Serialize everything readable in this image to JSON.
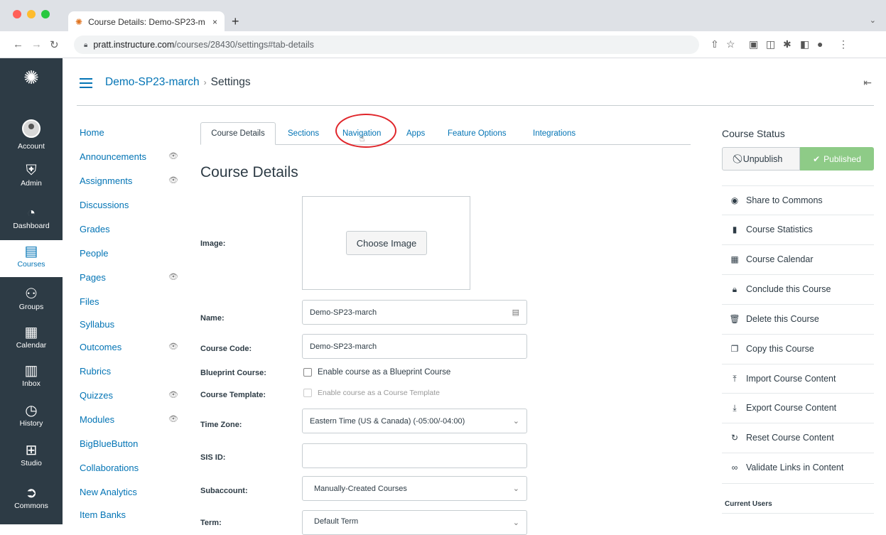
{
  "browser": {
    "tab_title": "Course Details: Demo-SP23-m",
    "tab_close": "×",
    "new_tab": "+",
    "url_host": "pratt.instructure.com",
    "url_path": "/courses/28430/settings#tab-details"
  },
  "global_nav": [
    {
      "label": "Account",
      "icon": "account-avatar"
    },
    {
      "label": "Admin",
      "icon": "shield-icon"
    },
    {
      "label": "Dashboard",
      "icon": "dashboard-icon"
    },
    {
      "label": "Courses",
      "icon": "courses-icon"
    },
    {
      "label": "Groups",
      "icon": "groups-icon"
    },
    {
      "label": "Calendar",
      "icon": "calendar-icon"
    },
    {
      "label": "Inbox",
      "icon": "inbox-icon"
    },
    {
      "label": "History",
      "icon": "history-icon"
    },
    {
      "label": "Studio",
      "icon": "studio-icon"
    },
    {
      "label": "Commons",
      "icon": "commons-icon"
    }
  ],
  "breadcrumb": {
    "course": "Demo-SP23-march",
    "page": "Settings"
  },
  "course_nav": [
    "Home",
    "Announcements",
    "Assignments",
    "Discussions",
    "Grades",
    "People",
    "Pages",
    "Files",
    "Syllabus",
    "Outcomes",
    "Rubrics",
    "Quizzes",
    "Modules",
    "BigBlueButton",
    "Collaborations",
    "New Analytics",
    "Item Banks"
  ],
  "tabs": {
    "details": "Course Details",
    "sections": "Sections",
    "navigation": "Navigation",
    "apps": "Apps",
    "feature_options": "Feature Options",
    "integrations": "Integrations"
  },
  "form": {
    "title": "Course Details",
    "image_label": "Image:",
    "choose_image": "Choose Image",
    "name_label": "Name:",
    "name_value": "Demo-SP23-march",
    "code_label": "Course Code:",
    "code_value": "Demo-SP23-march",
    "blueprint_label": "Blueprint Course:",
    "blueprint_option": "Enable course as a Blueprint Course",
    "template_label": "Course Template:",
    "template_option": "Enable course as a Course Template",
    "timezone_label": "Time Zone:",
    "timezone_value": "Eastern Time (US & Canada) (-05:00/-04:00)",
    "sis_label": "SIS ID:",
    "subaccount_label": "Subaccount:",
    "subaccount_value": "Manually-Created Courses",
    "term_label": "Term:",
    "term_value": "Default Term"
  },
  "status": {
    "title": "Course Status",
    "unpublish": "Unpublish",
    "published": "Published",
    "published_color": "#8ecb87"
  },
  "actions": [
    {
      "label": "Share to Commons",
      "icon": "commons-icon"
    },
    {
      "label": "Course Statistics",
      "icon": "statistics-icon"
    },
    {
      "label": "Course Calendar",
      "icon": "calendar-icon"
    },
    {
      "label": "Conclude this Course",
      "icon": "lock-icon"
    },
    {
      "label": "Delete this Course",
      "icon": "trash-icon"
    },
    {
      "label": "Copy this Course",
      "icon": "copy-icon"
    },
    {
      "label": "Import Course Content",
      "icon": "import-icon"
    },
    {
      "label": "Export Course Content",
      "icon": "export-icon"
    },
    {
      "label": "Reset Course Content",
      "icon": "reset-icon"
    },
    {
      "label": "Validate Links in Content",
      "icon": "link-icon"
    }
  ],
  "current_users": "Current Users",
  "colors": {
    "brand": "#0374b5",
    "nav_bg": "#2d3b45",
    "annotation": "#e0252a"
  }
}
